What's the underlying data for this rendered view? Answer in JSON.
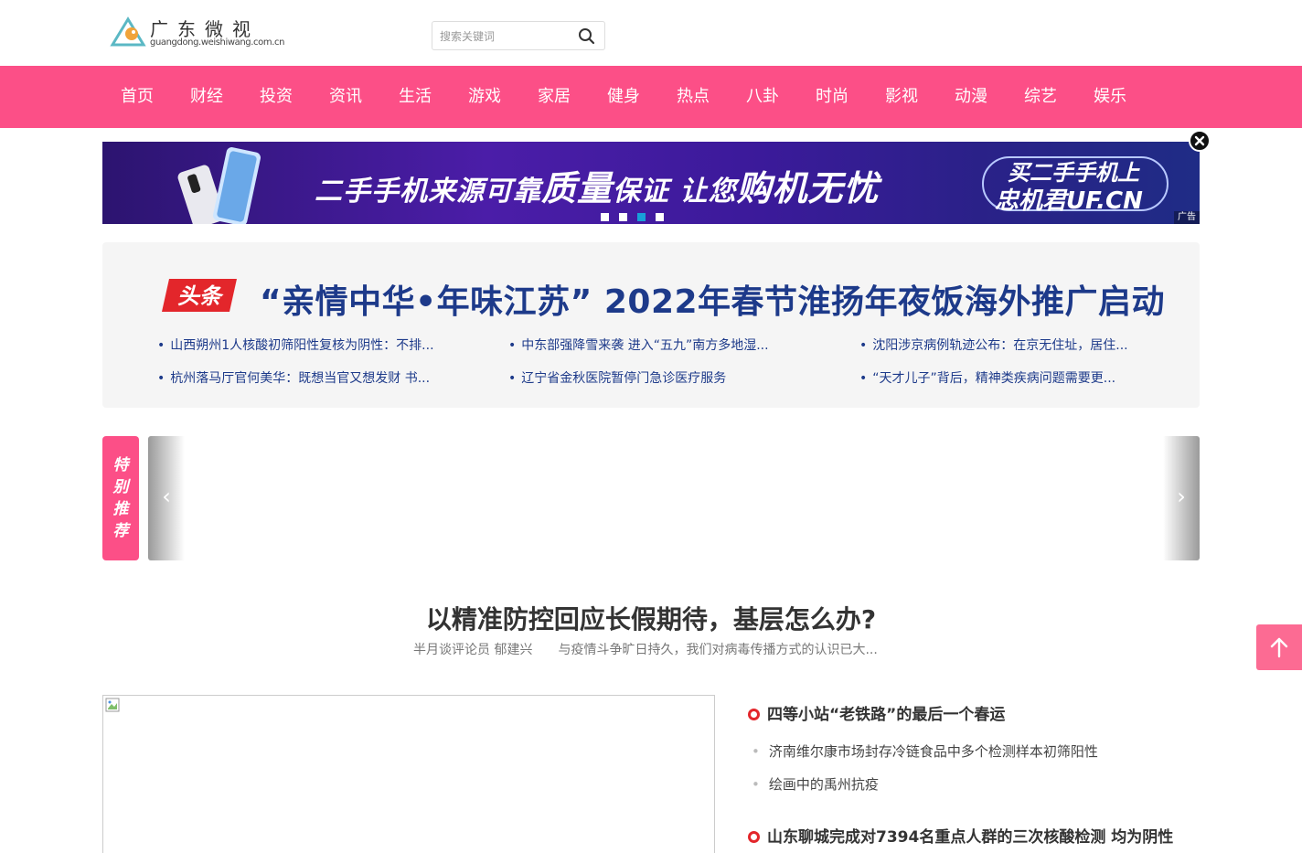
{
  "header": {
    "logo_title": "广东微视",
    "logo_domain": "guangdong.weishiwang.com.cn",
    "search_placeholder": "搜索关键词"
  },
  "nav": {
    "items": [
      "首页",
      "财经",
      "投资",
      "资讯",
      "生活",
      "游戏",
      "家居",
      "健身",
      "热点",
      "八卦",
      "时尚",
      "影视",
      "动漫",
      "综艺",
      "娱乐"
    ]
  },
  "banner": {
    "slogan_1": "二手手机来源可靠",
    "slogan_2": "质量",
    "slogan_3": "保证 让您",
    "slogan_4": "购机无忧",
    "brand_line_1": "买二手手机上",
    "brand_line_2": "忠机君UF.CN",
    "ad_tag": "广告",
    "slide_count": 4,
    "active_slide": 3
  },
  "headline": {
    "tag": "头条",
    "title": "“亲情中华•年味江苏” 2022年春节淮扬年夜饭海外推广启动",
    "items": [
      "山西朔州1人核酸初筛阳性复核为阴性：不排...",
      "中东部强降雪来袭 进入“五九”南方多地湿...",
      "沈阳涉京病例轨迹公布：在京无住址，居住...",
      "杭州落马厅官何美华：既想当官又想发财 书...",
      "辽宁省金秋医院暂停门急诊医疗服务",
      "“天才儿子”背后，精神类疾病问题需要更..."
    ]
  },
  "recommend": {
    "tag": "特别推荐",
    "prev": "‹",
    "next": "›"
  },
  "feature": {
    "title": "以精准防控回应长假期待，基层怎么办?",
    "author": "半月谈评论员 郁建兴",
    "summary": "与疫情斗争旷日持久，我们对病毒传播方式的认识已大..."
  },
  "news": {
    "head_1": "四等小站“老铁路”的最后一个春运",
    "subs_1": [
      "济南维尔康市场封存冷链食品中多个检测样本初筛阳性",
      "绘画中的禹州抗疫"
    ],
    "head_2": "山东聊城完成对7394名重点人群的三次核酸检测 均为阴性"
  },
  "colors": {
    "brand_pink": "#fc4f87",
    "headline_blue": "#1d3a8a",
    "ring_red": "#e3262b"
  }
}
